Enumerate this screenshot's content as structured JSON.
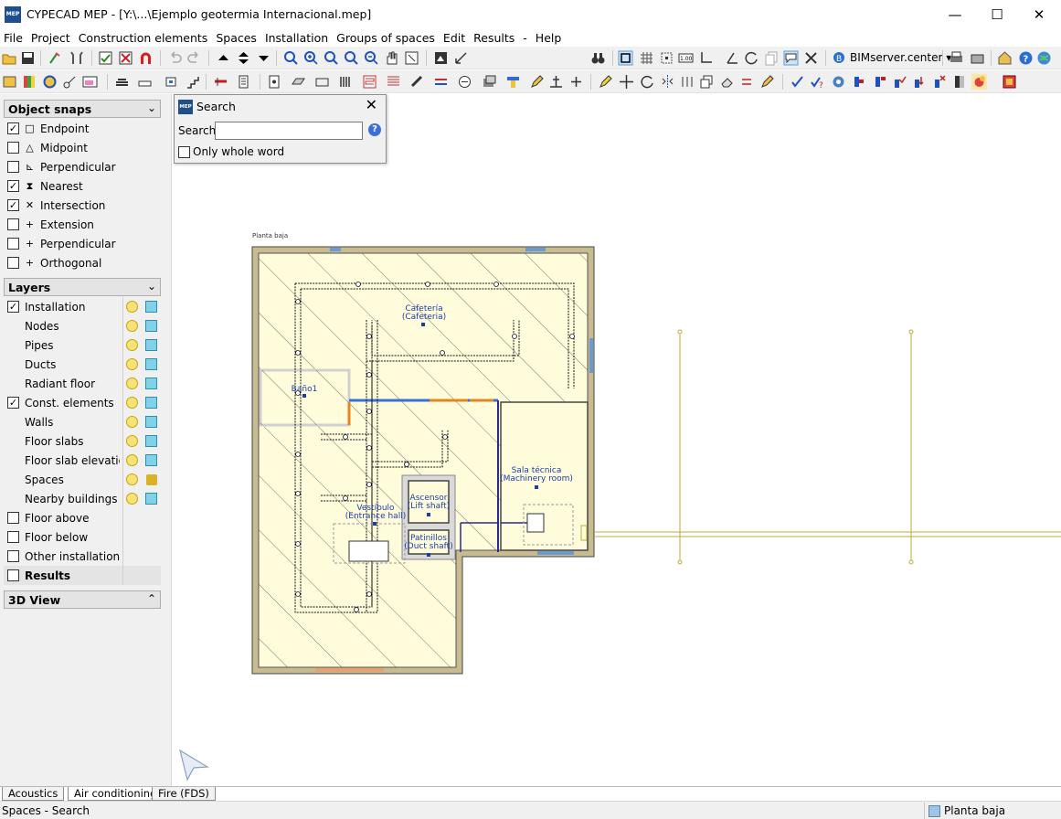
{
  "window": {
    "app_icon_text": "MEP",
    "title": "CYPECAD MEP - [Y:\\...\\Ejemplo geotermia Internacional.mep]",
    "minimize": "—",
    "maximize": "☐",
    "close": "✕"
  },
  "menu": [
    "File",
    "Project",
    "Construction elements",
    "Spaces",
    "Installation",
    "Groups of spaces",
    "Edit",
    "Results",
    "-",
    "Help"
  ],
  "toolbar": {
    "bimserver_label": "BIMserver.center ▾"
  },
  "colors": {
    "floor_fill": "#fffcdc",
    "wall_outer": "#c4b68c",
    "pipe": "#000000",
    "space_label": "#1c3caa",
    "beam_blue": "#3a6fd8",
    "beam_orange": "#e0881a",
    "external_lines": "#b8ae3a"
  },
  "object_snaps": {
    "header": "Object snaps",
    "chevron": "⌄",
    "items": [
      {
        "label": "Endpoint",
        "checked": true,
        "icon": "endpoint-icon",
        "glyph": "□"
      },
      {
        "label": "Midpoint",
        "checked": false,
        "icon": "midpoint-icon",
        "glyph": "△"
      },
      {
        "label": "Perpendicular",
        "checked": false,
        "icon": "perpendicular-icon",
        "glyph": "⊾"
      },
      {
        "label": "Nearest",
        "checked": true,
        "icon": "nearest-icon",
        "glyph": "⧗"
      },
      {
        "label": "Intersection",
        "checked": true,
        "icon": "intersection-icon",
        "glyph": "✕"
      },
      {
        "label": "Extension",
        "checked": false,
        "icon": "extension-icon",
        "glyph": "+"
      },
      {
        "label": "Perpendicular",
        "checked": false,
        "icon": "perpendicular-plus-icon",
        "glyph": "+"
      },
      {
        "label": "Orthogonal",
        "checked": false,
        "icon": "orthogonal-icon",
        "glyph": "+"
      }
    ]
  },
  "layers": {
    "header": "Layers",
    "chevron": "⌄",
    "items": [
      {
        "label": "Installation",
        "checkbox": true,
        "checked": true,
        "bulb": true,
        "lock": false
      },
      {
        "label": "Nodes",
        "checkbox": false,
        "checked": false,
        "bulb": true,
        "lock": false
      },
      {
        "label": "Pipes",
        "checkbox": false,
        "checked": false,
        "bulb": true,
        "lock": false
      },
      {
        "label": "Ducts",
        "checkbox": false,
        "checked": false,
        "bulb": true,
        "lock": false
      },
      {
        "label": "Radiant floor",
        "checkbox": false,
        "checked": false,
        "bulb": true,
        "lock": false
      },
      {
        "label": "Const. elements",
        "checkbox": true,
        "checked": true,
        "bulb": true,
        "lock": false
      },
      {
        "label": "Walls",
        "checkbox": false,
        "checked": false,
        "bulb": true,
        "lock": false
      },
      {
        "label": "Floor slabs",
        "checkbox": false,
        "checked": false,
        "bulb": true,
        "lock": false
      },
      {
        "label": "Floor slab elevation ch",
        "checkbox": false,
        "checked": false,
        "bulb": true,
        "lock": false
      },
      {
        "label": "Spaces",
        "checkbox": false,
        "checked": false,
        "bulb": true,
        "lock": true
      },
      {
        "label": "Nearby buildings and p",
        "checkbox": false,
        "checked": false,
        "bulb": true,
        "lock": false
      },
      {
        "label": "Floor above",
        "checkbox": true,
        "checked": false,
        "bulb": false,
        "lock": false
      },
      {
        "label": "Floor below",
        "checkbox": true,
        "checked": false,
        "bulb": false,
        "lock": false
      },
      {
        "label": "Other installations",
        "checkbox": true,
        "checked": false,
        "bulb": false,
        "lock": false
      },
      {
        "label": "Results",
        "checkbox": true,
        "checked": false,
        "bulb": false,
        "lock": false,
        "bold": true
      }
    ]
  },
  "view3d": {
    "header": "3D View",
    "chevron": "⌃"
  },
  "search_dialog": {
    "icon_text": "MEP",
    "title": "Search",
    "search_label": "Search",
    "search_value": "",
    "whole_word_label": "Only whole word",
    "whole_word_checked": false,
    "help_glyph": "?",
    "close_glyph": "✕"
  },
  "drawing": {
    "floor_name": "Planta  baja",
    "spaces": [
      {
        "name": "Cafetería",
        "sub": "(Cafeteria)"
      },
      {
        "name": "Baño1",
        "sub": ""
      },
      {
        "name": "Sala técnica",
        "sub": "(Machinery room)"
      },
      {
        "name": "Ascensor",
        "sub": "(Lift shaft)"
      },
      {
        "name": "Vestíbulo",
        "sub": "(Entrance hall)"
      },
      {
        "name": "Patinillos",
        "sub": "(Duct shaft)"
      }
    ]
  },
  "bottom_tabs": [
    "Acoustics",
    "Air conditioning",
    "Fire (FDS)"
  ],
  "status": {
    "left": "Spaces - Search",
    "floor": "Planta baja"
  }
}
